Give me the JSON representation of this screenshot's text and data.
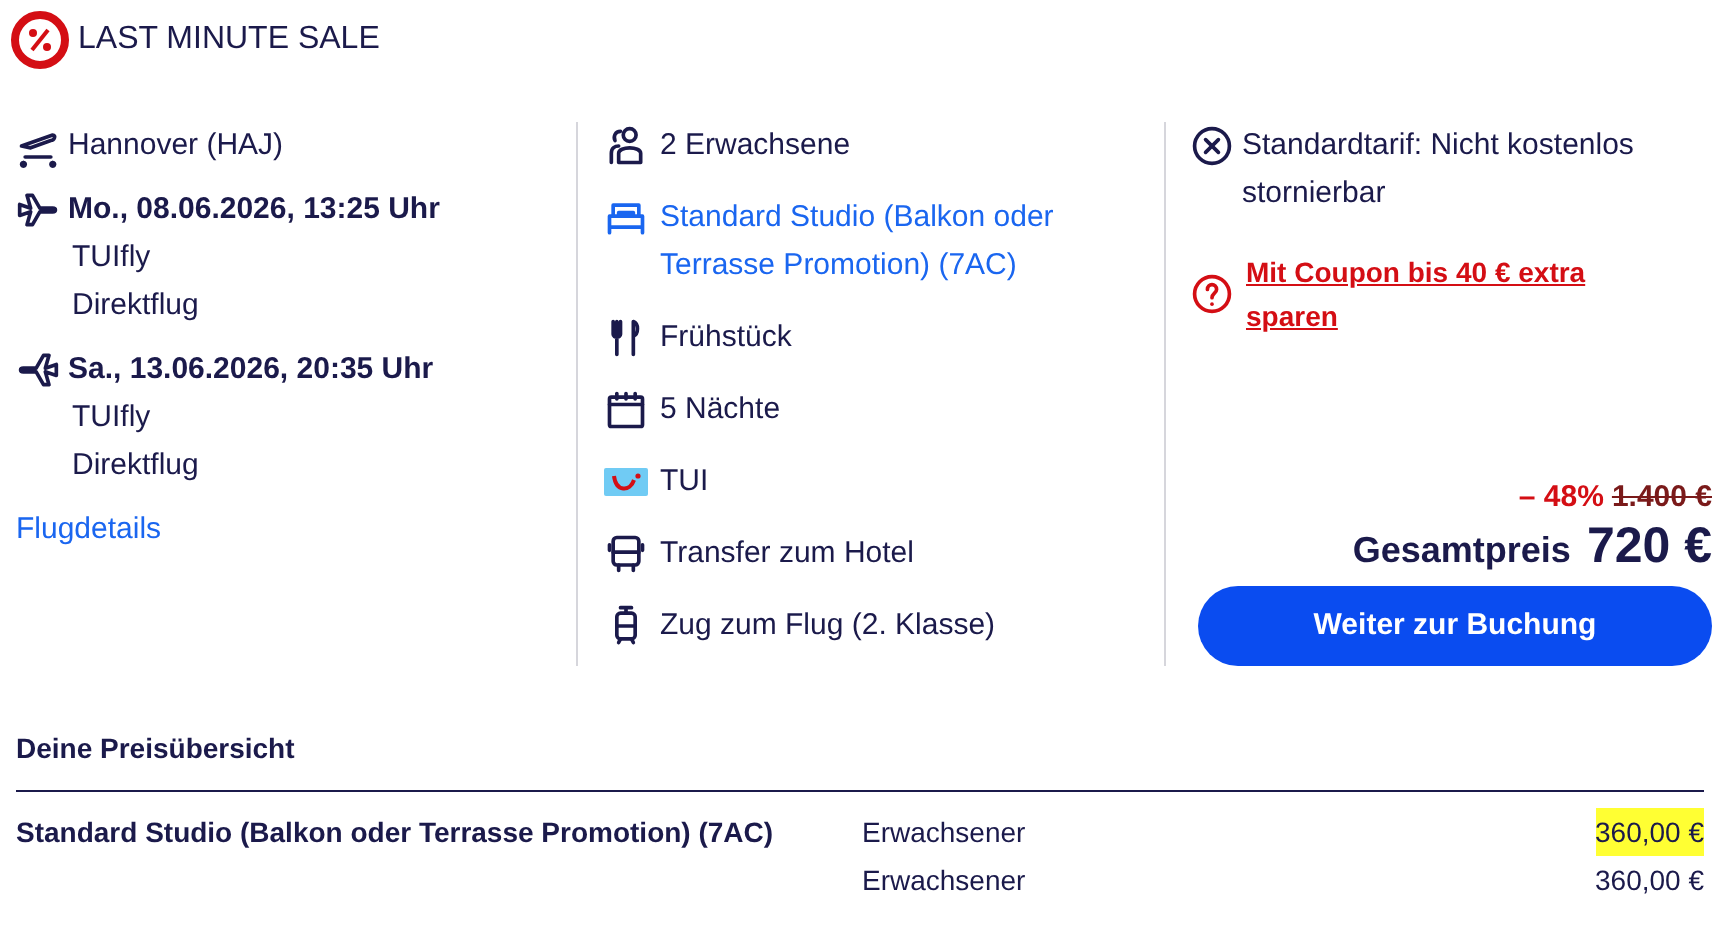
{
  "badge": {
    "title": "LAST MINUTE SALE"
  },
  "flight": {
    "airport": "Hannover (HAJ)",
    "legs": [
      {
        "kind": "outbound",
        "datetime": "Mo., 08.06.2026, 13:25 Uhr",
        "airline": "TUIfly",
        "type": "Direktflug"
      },
      {
        "kind": "return",
        "datetime": "Sa., 13.06.2026, 20:35 Uhr",
        "airline": "TUIfly",
        "type": "Direktflug"
      }
    ],
    "details_link": "Flugdetails"
  },
  "services": [
    {
      "kind": "travellers",
      "text": "2 Erwachsene"
    },
    {
      "kind": "room",
      "text": "Standard Studio (Balkon oder Terrasse Promotion) (7AC)"
    },
    {
      "kind": "board",
      "text": "Frühstück"
    },
    {
      "kind": "duration",
      "text": "5 Nächte"
    },
    {
      "kind": "operator",
      "text": "TUI"
    },
    {
      "kind": "transfer",
      "text": "Transfer zum Hotel"
    },
    {
      "kind": "train",
      "text": "Zug zum Flug (2. Klasse)"
    }
  ],
  "tariff": "Standardtarif: Nicht kostenlos stornierbar",
  "coupon_link": "Mit Coupon bis 40 € extra sparen",
  "price": {
    "discount": "– 48%",
    "original": "1.400 €",
    "label": "Gesamtpreis",
    "total": "720 €"
  },
  "cta": "Weiter zur Buchung",
  "price_overview": {
    "title": "Deine Preisübersicht",
    "rows": [
      {
        "item": "Standard Studio (Balkon oder Terrasse Promotion) (7AC)",
        "lines": [
          {
            "label": "Erwachsener",
            "amount": "360,00 €",
            "highlighted": true
          },
          {
            "label": "Erwachsener",
            "amount": "360,00 €",
            "highlighted": false
          }
        ]
      }
    ]
  }
}
